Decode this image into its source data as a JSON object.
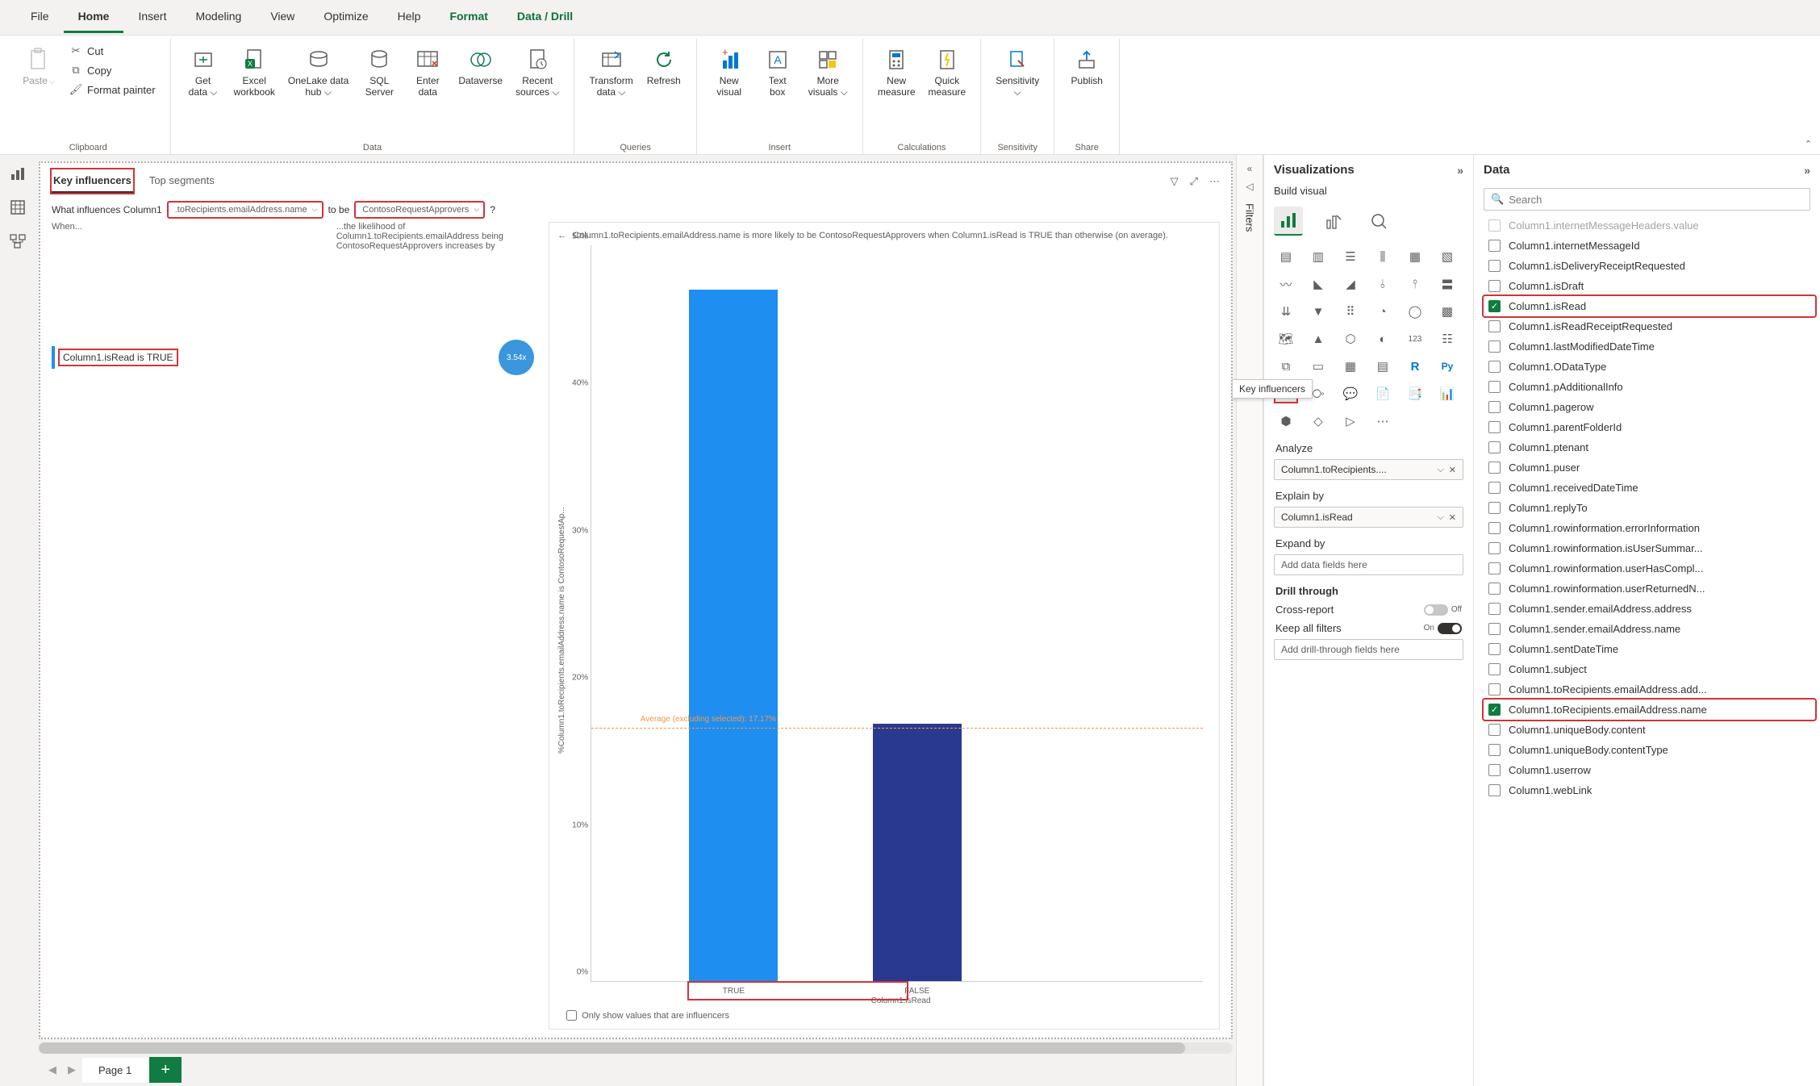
{
  "ribbon_tabs": {
    "file": "File",
    "home": "Home",
    "insert": "Insert",
    "modeling": "Modeling",
    "view": "View",
    "optimize": "Optimize",
    "help": "Help",
    "format": "Format",
    "data_drill": "Data / Drill"
  },
  "ribbon": {
    "paste": "Paste",
    "cut": "Cut",
    "copy": "Copy",
    "fmt_painter": "Format painter",
    "clipboard": "Clipboard",
    "get_data": "Get\ndata ⌵",
    "excel_wb": "Excel\nworkbook",
    "onelake": "OneLake data\nhub ⌵",
    "sql": "SQL\nServer",
    "enter_data": "Enter\ndata",
    "dataverse": "Dataverse",
    "recent": "Recent\nsources ⌵",
    "data_group": "Data",
    "transform": "Transform\ndata ⌵",
    "refresh": "Refresh",
    "queries": "Queries",
    "new_visual": "New\nvisual",
    "text_box": "Text\nbox",
    "more_viz": "More\nvisuals ⌵",
    "insert_group": "Insert",
    "new_measure": "New\nmeasure",
    "quick_measure": "Quick\nmeasure",
    "calc": "Calculations",
    "sensitivity": "Sensitivity\n⌵",
    "sens_group": "Sensitivity",
    "publish": "Publish",
    "share": "Share"
  },
  "ki": {
    "tab1": "Key influencers",
    "tab2": "Top segments",
    "q_prefix": "What influences Column1",
    "pill1": ".toRecipients.emailAddress.name",
    "q_mid": "to be",
    "pill2": "ContosoRequestApprovers",
    "q_suffix": "?",
    "when": "When...",
    "like": "...the likelihood of Column1.toRecipients.emailAddress being ContosoRequestApprovers increases by",
    "inf_text": "Column1.isRead is TRUE",
    "bubble": "3.54x",
    "chart_desc": "Column1.toRecipients.emailAddress.name is more likely to be ContosoRequestApprovers when Column1.isRead is TRUE than otherwise (on average).",
    "avg_label": "Average (excluding selected): 17.17%",
    "only_show": "Only show values that are influencers"
  },
  "chart_data": {
    "type": "bar",
    "categories": [
      "TRUE",
      "FALSE"
    ],
    "values": [
      47,
      17.5
    ],
    "xlabel": "Column1.isRead",
    "ylabel": "%Column1.toRecipients.emailAddress.name is ContosoRequestAp...",
    "ylim": [
      0,
      50
    ],
    "yticks": [
      "0%",
      "10%",
      "20%",
      "30%",
      "40%",
      "50%"
    ],
    "average_excl_selected": 17.17
  },
  "viz_pane": {
    "title": "Visualizations",
    "sub": "Build visual",
    "tooltip": "Key influencers",
    "analyze": "Analyze",
    "analyze_val": "Column1.toRecipients....",
    "explain": "Explain by",
    "explain_val": "Column1.isRead",
    "expand": "Expand by",
    "expand_ph": "Add data fields here",
    "drill": "Drill through",
    "cross": "Cross-report",
    "off": "Off",
    "keep": "Keep all filters",
    "on": "On",
    "drill_ph": "Add drill-through fields here"
  },
  "data_pane": {
    "title": "Data",
    "search_ph": "Search",
    "fields": [
      {
        "n": "Column1.internetMessageHeaders.value",
        "c": false,
        "dim": true
      },
      {
        "n": "Column1.internetMessageId",
        "c": false
      },
      {
        "n": "Column1.isDeliveryReceiptRequested",
        "c": false
      },
      {
        "n": "Column1.isDraft",
        "c": false
      },
      {
        "n": "Column1.isRead",
        "c": true,
        "red": true
      },
      {
        "n": "Column1.isReadReceiptRequested",
        "c": false
      },
      {
        "n": "Column1.lastModifiedDateTime",
        "c": false
      },
      {
        "n": "Column1.ODataType",
        "c": false
      },
      {
        "n": "Column1.pAdditionalInfo",
        "c": false
      },
      {
        "n": "Column1.pagerow",
        "c": false
      },
      {
        "n": "Column1.parentFolderId",
        "c": false
      },
      {
        "n": "Column1.ptenant",
        "c": false
      },
      {
        "n": "Column1.puser",
        "c": false
      },
      {
        "n": "Column1.receivedDateTime",
        "c": false
      },
      {
        "n": "Column1.replyTo",
        "c": false
      },
      {
        "n": "Column1.rowinformation.errorInformation",
        "c": false
      },
      {
        "n": "Column1.rowinformation.isUserSummar...",
        "c": false
      },
      {
        "n": "Column1.rowinformation.userHasCompl...",
        "c": false
      },
      {
        "n": "Column1.rowinformation.userReturnedN...",
        "c": false
      },
      {
        "n": "Column1.sender.emailAddress.address",
        "c": false
      },
      {
        "n": "Column1.sender.emailAddress.name",
        "c": false
      },
      {
        "n": "Column1.sentDateTime",
        "c": false
      },
      {
        "n": "Column1.subject",
        "c": false
      },
      {
        "n": "Column1.toRecipients.emailAddress.add...",
        "c": false
      },
      {
        "n": "Column1.toRecipients.emailAddress.name",
        "c": true,
        "red": true
      },
      {
        "n": "Column1.uniqueBody.content",
        "c": false
      },
      {
        "n": "Column1.uniqueBody.contentType",
        "c": false
      },
      {
        "n": "Column1.userrow",
        "c": false
      },
      {
        "n": "Column1.webLink",
        "c": false
      }
    ]
  },
  "page_tab": "Page 1",
  "filters_label": "Filters"
}
